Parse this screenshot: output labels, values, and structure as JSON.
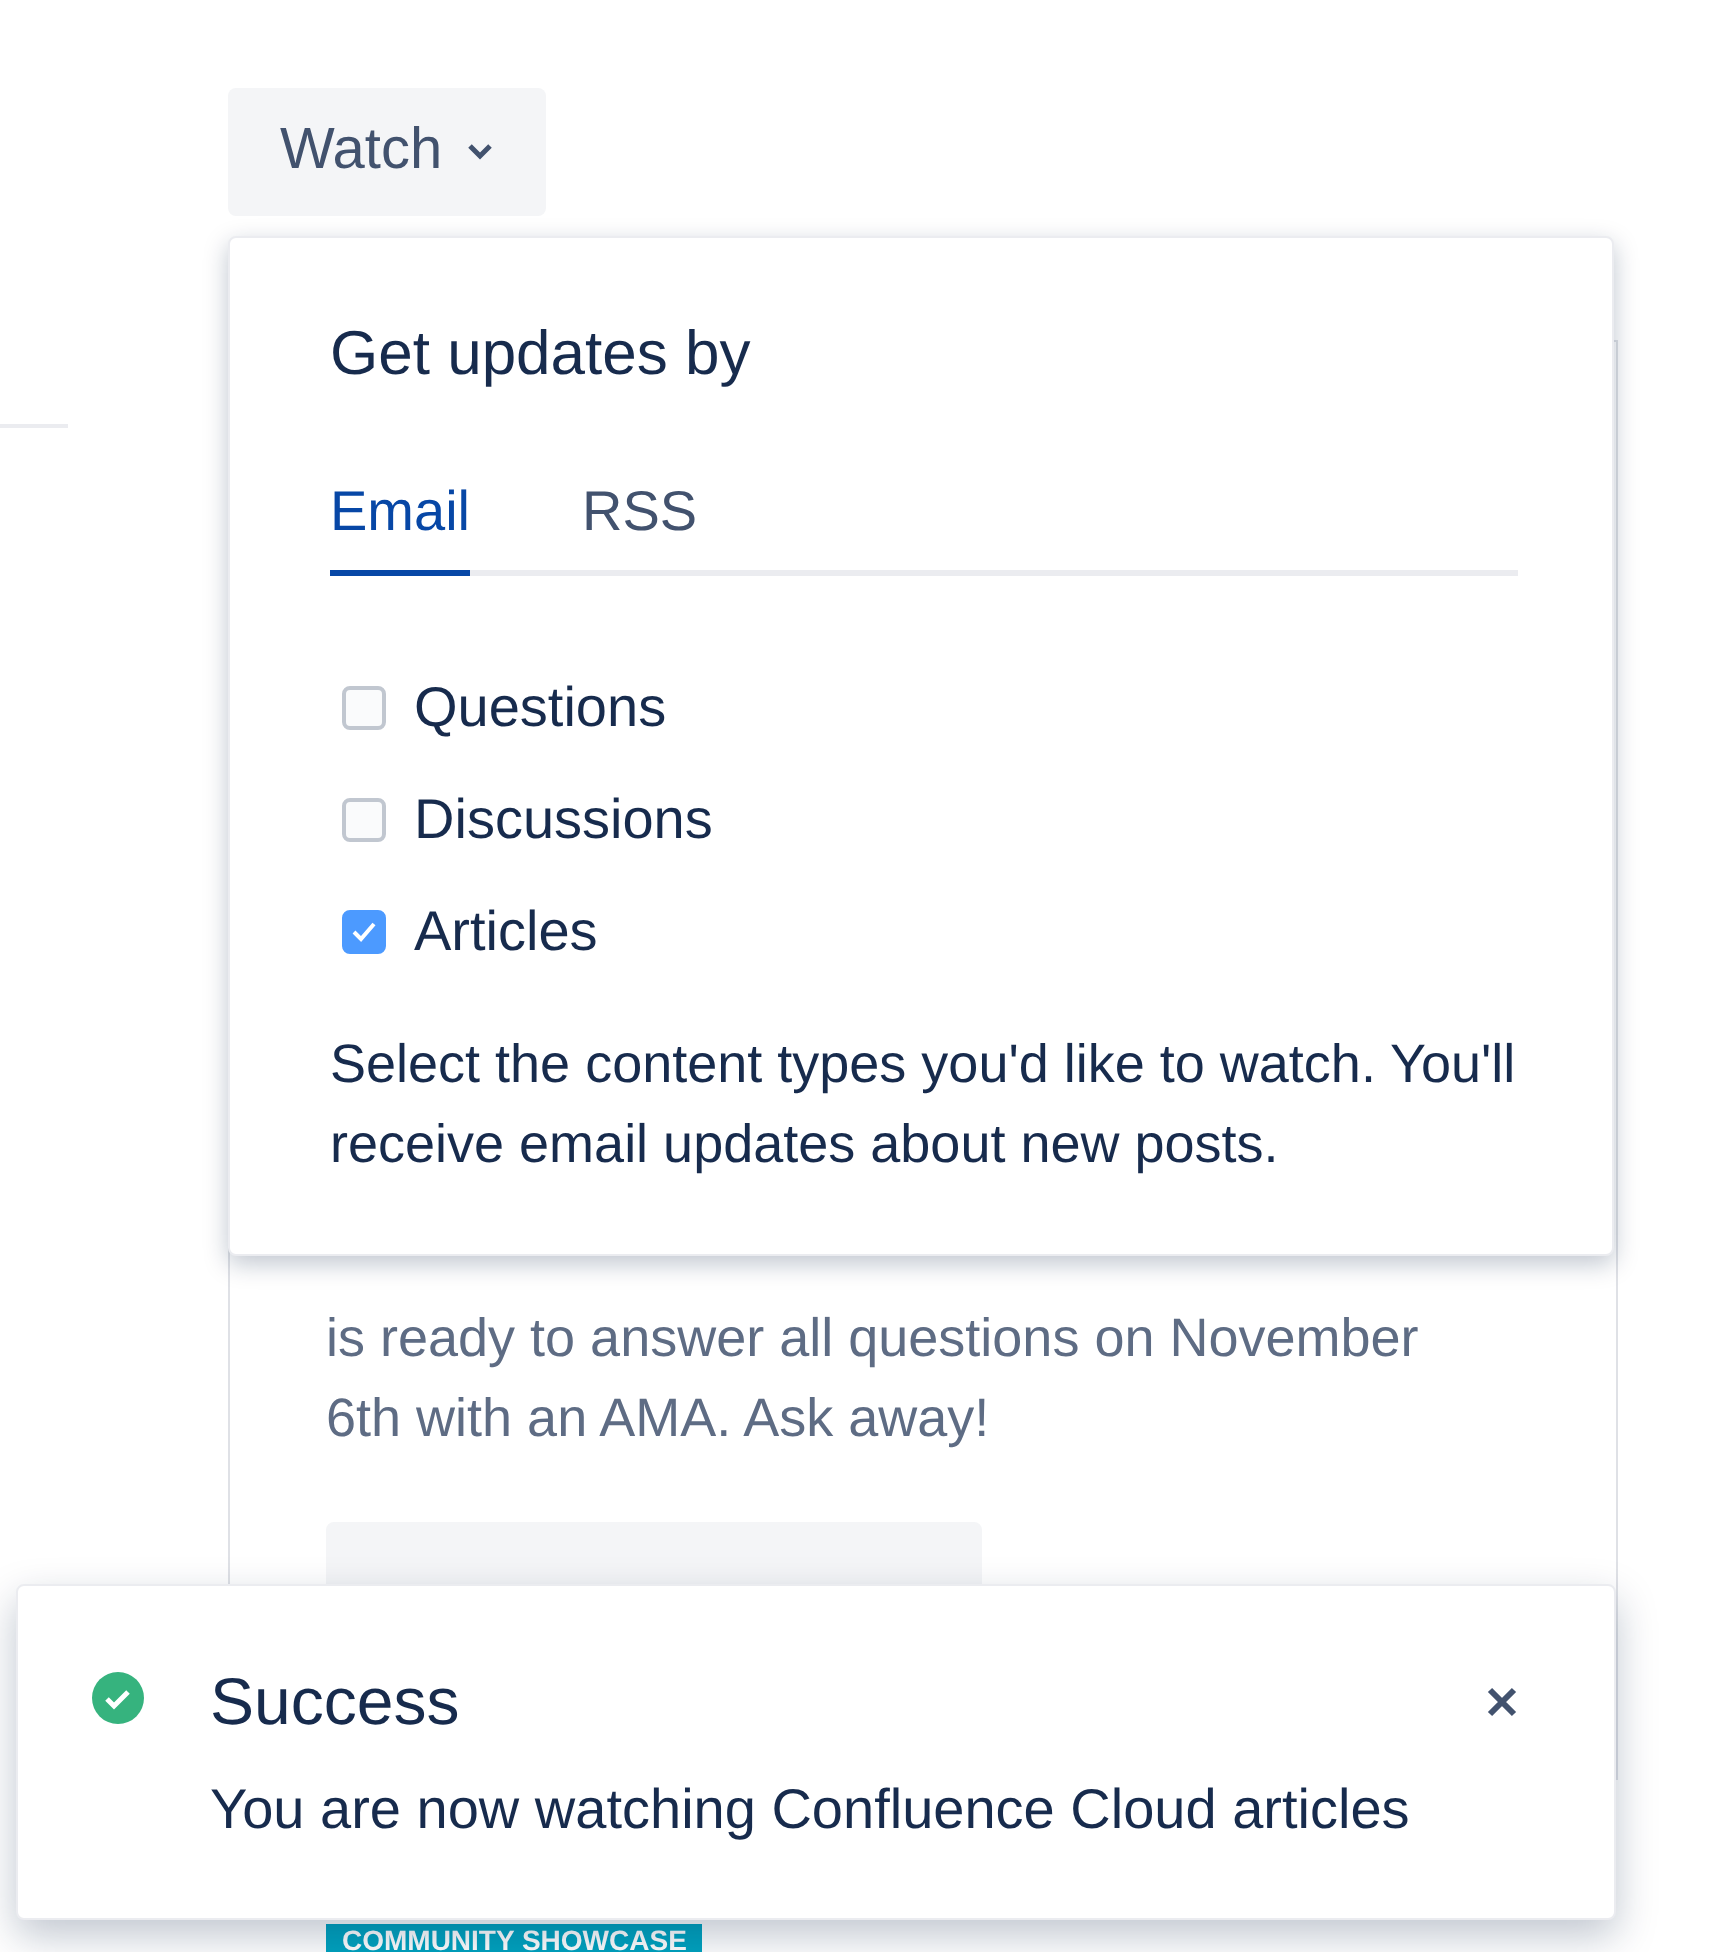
{
  "watch_button": {
    "label": "Watch"
  },
  "card": {
    "paragraph": "is ready to answer all questions on November 6th with an AMA. Ask away!",
    "tag": "COMMUNITY SHOWCASE"
  },
  "dropdown": {
    "title": "Get updates by",
    "tabs": [
      {
        "label": "Email",
        "selected": true
      },
      {
        "label": "RSS",
        "selected": false
      }
    ],
    "options": [
      {
        "label": "Questions",
        "checked": false
      },
      {
        "label": "Discussions",
        "checked": false
      },
      {
        "label": "Articles",
        "checked": true
      }
    ],
    "help": "Select the content types you'd like to watch. You'll receive email updates about new posts."
  },
  "toast": {
    "title": "Success",
    "message": "You are now watching Confluence Cloud articles"
  }
}
